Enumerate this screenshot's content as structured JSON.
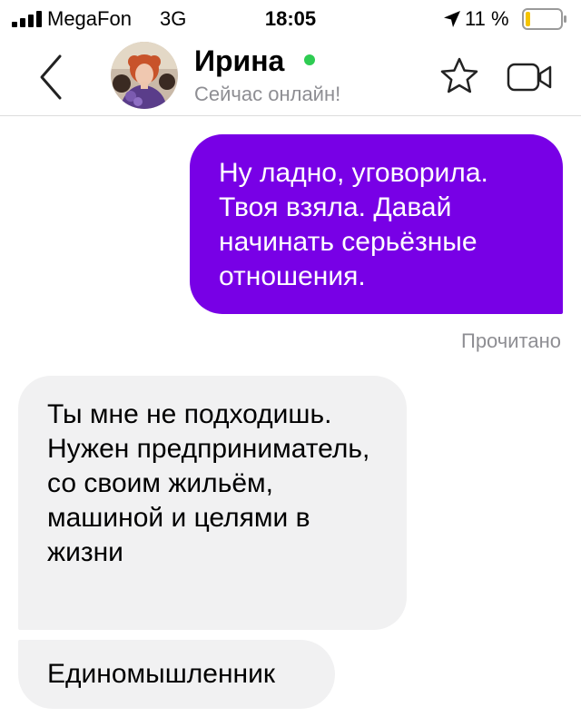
{
  "status_bar": {
    "carrier": "MegaFon",
    "network": "3G",
    "time": "18:05",
    "battery_percent": "11 %",
    "battery_level": 0.11,
    "icons": [
      "signal-bars-icon",
      "location-arrow-icon",
      "battery-icon"
    ]
  },
  "header": {
    "contact_name": "Ирина",
    "contact_status": "Сейчас онлайн!",
    "online": true,
    "icons": [
      "back-chevron-icon",
      "star-icon",
      "video-camera-icon"
    ]
  },
  "messages": [
    {
      "direction": "outgoing",
      "text": "Ну ладно, уговорила. Твоя взяла. Давай начинать серьёзные отношения."
    },
    {
      "direction": "incoming",
      "text": "Ты мне не подходишь. Нужен предприниматель, со своим жильём, машиной и целями в жизни"
    },
    {
      "direction": "incoming",
      "text": "Единомышленник"
    }
  ],
  "read_status": "Прочитано",
  "colors": {
    "outgoing_bubble": "#7800e6",
    "incoming_bubble": "#f1f1f2",
    "online_dot": "#2ecc52",
    "secondary_text": "#8e8e93",
    "battery_low": "#f5c400"
  }
}
